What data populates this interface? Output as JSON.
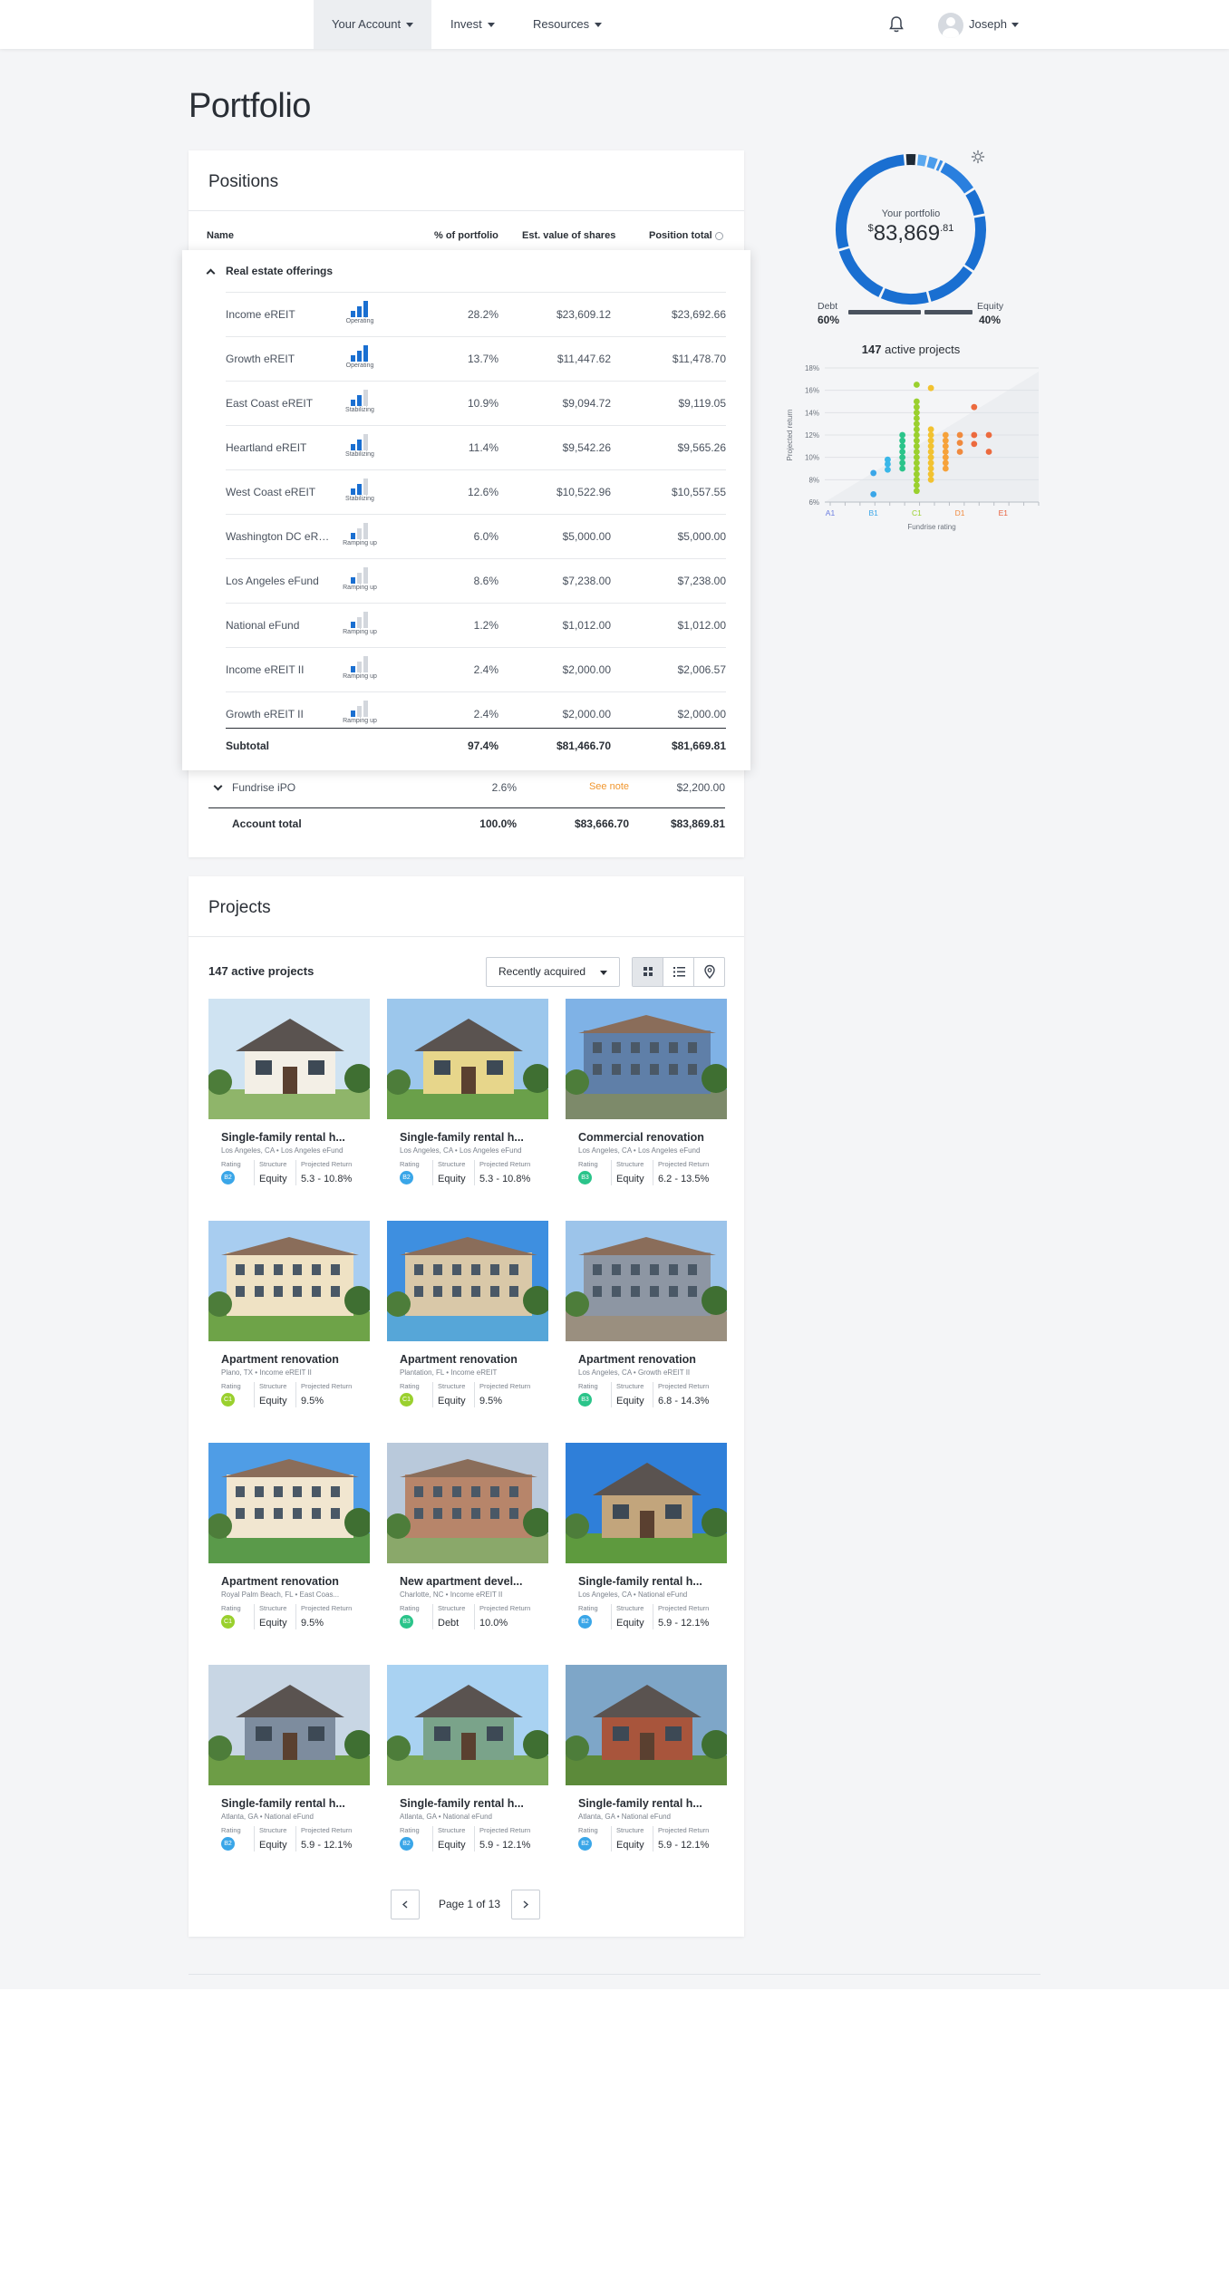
{
  "nav": {
    "items": [
      {
        "label": "Your Account"
      },
      {
        "label": "Invest"
      },
      {
        "label": "Resources"
      }
    ],
    "user": "Joseph"
  },
  "page_title": "Portfolio",
  "positions": {
    "title": "Positions",
    "headers": {
      "name": "Name",
      "pct": "% of portfolio",
      "est": "Est. value of shares",
      "total": "Position total"
    },
    "group": {
      "label": "Real estate offerings",
      "rows": [
        {
          "name": "Income eREIT",
          "status": "Operating",
          "level": 3,
          "pct": "28.2%",
          "est": "$23,609.12",
          "total": "$23,692.66"
        },
        {
          "name": "Growth eREIT",
          "status": "Operating",
          "level": 3,
          "pct": "13.7%",
          "est": "$11,447.62",
          "total": "$11,478.70"
        },
        {
          "name": "East Coast eREIT",
          "status": "Stabilizing",
          "level": 2,
          "pct": "10.9%",
          "est": "$9,094.72",
          "total": "$9,119.05"
        },
        {
          "name": "Heartland eREIT",
          "status": "Stabilizing",
          "level": 2,
          "pct": "11.4%",
          "est": "$9,542.26",
          "total": "$9,565.26"
        },
        {
          "name": "West Coast eREIT",
          "status": "Stabilizing",
          "level": 2,
          "pct": "12.6%",
          "est": "$10,522.96",
          "total": "$10,557.55"
        },
        {
          "name": "Washington DC eREIT",
          "status": "Ramping up",
          "level": 1,
          "pct": "6.0%",
          "est": "$5,000.00",
          "total": "$5,000.00"
        },
        {
          "name": "Los Angeles eFund",
          "status": "Ramping up",
          "level": 1,
          "pct": "8.6%",
          "est": "$7,238.00",
          "total": "$7,238.00"
        },
        {
          "name": "National eFund",
          "status": "Ramping up",
          "level": 1,
          "pct": "1.2%",
          "est": "$1,012.00",
          "total": "$1,012.00"
        },
        {
          "name": "Income eREIT II",
          "status": "Ramping up",
          "level": 1,
          "pct": "2.4%",
          "est": "$2,000.00",
          "total": "$2,006.57"
        },
        {
          "name": "Growth eREIT II",
          "status": "Ramping up",
          "level": 1,
          "pct": "2.4%",
          "est": "$2,000.00",
          "total": "$2,000.00"
        }
      ],
      "subtotal": {
        "label": "Subtotal",
        "pct": "97.4%",
        "est": "$81,466.70",
        "total": "$81,669.81"
      }
    },
    "ipo": {
      "name": "Fundrise iPO",
      "pct": "2.6%",
      "est": "See note",
      "total": "$2,200.00"
    },
    "account_total": {
      "label": "Account total",
      "pct": "100.0%",
      "est": "$83,666.70",
      "total": "$83,869.81"
    }
  },
  "projects": {
    "title": "Projects",
    "count_label": "147 active projects",
    "sort_label": "Recently acquired",
    "meta_labels": {
      "rating": "Rating",
      "structure": "Structure",
      "return": "Projected Return"
    },
    "items": [
      {
        "title": "Single-family rental h...",
        "loc": "Los Angeles, CA • Los Angeles eFund",
        "rating": "B2",
        "structure": "Equity",
        "ret": "5.3 - 10.8%"
      },
      {
        "title": "Single-family rental h...",
        "loc": "Los Angeles, CA • Los Angeles eFund",
        "rating": "B2",
        "structure": "Equity",
        "ret": "5.3 - 10.8%"
      },
      {
        "title": "Commercial renovation",
        "loc": "Los Angeles, CA • Los Angeles eFund",
        "rating": "B3",
        "structure": "Equity",
        "ret": "6.2 - 13.5%"
      },
      {
        "title": "Apartment renovation",
        "loc": "Plano, TX • Income eREIT II",
        "rating": "C1",
        "structure": "Equity",
        "ret": "9.5%"
      },
      {
        "title": "Apartment renovation",
        "loc": "Plantation, FL • Income eREIT",
        "rating": "C1",
        "structure": "Equity",
        "ret": "9.5%"
      },
      {
        "title": "Apartment renovation",
        "loc": "Los Angeles, CA • Growth eREIT II",
        "rating": "B3",
        "structure": "Equity",
        "ret": "6.8 - 14.3%"
      },
      {
        "title": "Apartment renovation",
        "loc": "Royal Palm Beach, FL • East Coas...",
        "rating": "C1",
        "structure": "Equity",
        "ret": "9.5%"
      },
      {
        "title": "New apartment devel...",
        "loc": "Charlotte, NC • Income eREIT II",
        "rating": "B3",
        "structure": "Debt",
        "ret": "10.0%"
      },
      {
        "title": "Single-family rental h...",
        "loc": "Los Angeles, CA • National eFund",
        "rating": "B2",
        "structure": "Equity",
        "ret": "5.9 - 12.1%"
      },
      {
        "title": "Single-family rental h...",
        "loc": "Atlanta, GA • National eFund",
        "rating": "B2",
        "structure": "Equity",
        "ret": "5.9 - 12.1%"
      },
      {
        "title": "Single-family rental h...",
        "loc": "Atlanta, GA • National eFund",
        "rating": "B2",
        "structure": "Equity",
        "ret": "5.9 - 12.1%"
      },
      {
        "title": "Single-family rental h...",
        "loc": "Atlanta, GA • National eFund",
        "rating": "B2",
        "structure": "Equity",
        "ret": "5.9 - 12.1%"
      }
    ],
    "rating_colors": {
      "B2": "#3aa6e8",
      "B3": "#2bc48a",
      "C1": "#9ad02e"
    },
    "pager": {
      "label": "Page 1 of 13"
    }
  },
  "summary": {
    "donut_label": "Your portfolio",
    "value_main": "83,869",
    "value_currency": "$",
    "value_cents": ".81",
    "debt_label": "Debt",
    "debt_value": "60%",
    "equity_label": "Equity",
    "equity_value": "40%",
    "active_count": "147",
    "active_text": "active projects"
  },
  "chart_data": {
    "type": "scatter",
    "xlabel": "Fundrise rating",
    "ylabel": "Projected return",
    "categories": [
      "A1",
      "B1",
      "C1",
      "D1",
      "E1"
    ],
    "yticks": [
      "18%",
      "16%",
      "14%",
      "12%",
      "10%",
      "8%",
      "6%"
    ],
    "ylim": [
      6,
      18
    ],
    "colors": {
      "A1": "#6b7de0",
      "B1": "#3aa6e8",
      "B2": "#3ab7e8",
      "B3": "#2bc48a",
      "C1": "#9ad02e",
      "C2": "#f2c230",
      "C3": "#f6a23a",
      "D1": "#f08a3e",
      "D2": "#ec6a3e"
    },
    "points": [
      {
        "x": 2.0,
        "y": 6.7,
        "c": "B1"
      },
      {
        "x": 2.0,
        "y": 8.6,
        "c": "B1"
      },
      {
        "x": 2.33,
        "y": 8.9,
        "c": "B2"
      },
      {
        "x": 2.33,
        "y": 9.4,
        "c": "B2"
      },
      {
        "x": 2.33,
        "y": 9.8,
        "c": "B2"
      },
      {
        "x": 2.67,
        "y": 9.0,
        "c": "B3"
      },
      {
        "x": 2.67,
        "y": 9.5,
        "c": "B3"
      },
      {
        "x": 2.67,
        "y": 10.0,
        "c": "B3"
      },
      {
        "x": 2.67,
        "y": 10.5,
        "c": "B3"
      },
      {
        "x": 2.67,
        "y": 11.0,
        "c": "B3"
      },
      {
        "x": 2.67,
        "y": 11.5,
        "c": "B3"
      },
      {
        "x": 2.67,
        "y": 12.0,
        "c": "B3"
      },
      {
        "x": 3.0,
        "y": 7.0,
        "c": "C1"
      },
      {
        "x": 3.0,
        "y": 7.5,
        "c": "C1"
      },
      {
        "x": 3.0,
        "y": 8.0,
        "c": "C1"
      },
      {
        "x": 3.0,
        "y": 8.5,
        "c": "C1"
      },
      {
        "x": 3.0,
        "y": 9.0,
        "c": "C1"
      },
      {
        "x": 3.0,
        "y": 9.5,
        "c": "C1"
      },
      {
        "x": 3.0,
        "y": 10.0,
        "c": "C1"
      },
      {
        "x": 3.0,
        "y": 10.5,
        "c": "C1"
      },
      {
        "x": 3.0,
        "y": 11.0,
        "c": "C1"
      },
      {
        "x": 3.0,
        "y": 11.5,
        "c": "C1"
      },
      {
        "x": 3.0,
        "y": 12.0,
        "c": "C1"
      },
      {
        "x": 3.0,
        "y": 12.5,
        "c": "C1"
      },
      {
        "x": 3.0,
        "y": 13.0,
        "c": "C1"
      },
      {
        "x": 3.0,
        "y": 13.5,
        "c": "C1"
      },
      {
        "x": 3.0,
        "y": 14.0,
        "c": "C1"
      },
      {
        "x": 3.0,
        "y": 14.5,
        "c": "C1"
      },
      {
        "x": 3.0,
        "y": 15.0,
        "c": "C1"
      },
      {
        "x": 3.0,
        "y": 16.5,
        "c": "C1"
      },
      {
        "x": 3.33,
        "y": 8.0,
        "c": "C2"
      },
      {
        "x": 3.33,
        "y": 8.5,
        "c": "C2"
      },
      {
        "x": 3.33,
        "y": 9.0,
        "c": "C2"
      },
      {
        "x": 3.33,
        "y": 9.5,
        "c": "C2"
      },
      {
        "x": 3.33,
        "y": 10.0,
        "c": "C2"
      },
      {
        "x": 3.33,
        "y": 10.5,
        "c": "C2"
      },
      {
        "x": 3.33,
        "y": 11.0,
        "c": "C2"
      },
      {
        "x": 3.33,
        "y": 11.5,
        "c": "C2"
      },
      {
        "x": 3.33,
        "y": 12.0,
        "c": "C2"
      },
      {
        "x": 3.33,
        "y": 12.5,
        "c": "C2"
      },
      {
        "x": 3.33,
        "y": 16.2,
        "c": "C2"
      },
      {
        "x": 3.67,
        "y": 9.0,
        "c": "C3"
      },
      {
        "x": 3.67,
        "y": 9.5,
        "c": "C3"
      },
      {
        "x": 3.67,
        "y": 10.0,
        "c": "C3"
      },
      {
        "x": 3.67,
        "y": 10.5,
        "c": "C3"
      },
      {
        "x": 3.67,
        "y": 11.0,
        "c": "C3"
      },
      {
        "x": 3.67,
        "y": 11.5,
        "c": "C3"
      },
      {
        "x": 3.67,
        "y": 12.0,
        "c": "C3"
      },
      {
        "x": 4.0,
        "y": 10.5,
        "c": "D1"
      },
      {
        "x": 4.0,
        "y": 11.3,
        "c": "D1"
      },
      {
        "x": 4.0,
        "y": 12.0,
        "c": "D1"
      },
      {
        "x": 4.33,
        "y": 11.2,
        "c": "D2"
      },
      {
        "x": 4.33,
        "y": 12.0,
        "c": "D2"
      },
      {
        "x": 4.33,
        "y": 14.5,
        "c": "D2"
      },
      {
        "x": 4.67,
        "y": 10.5,
        "c": "D2"
      },
      {
        "x": 4.67,
        "y": 12.0,
        "c": "D2"
      }
    ]
  }
}
